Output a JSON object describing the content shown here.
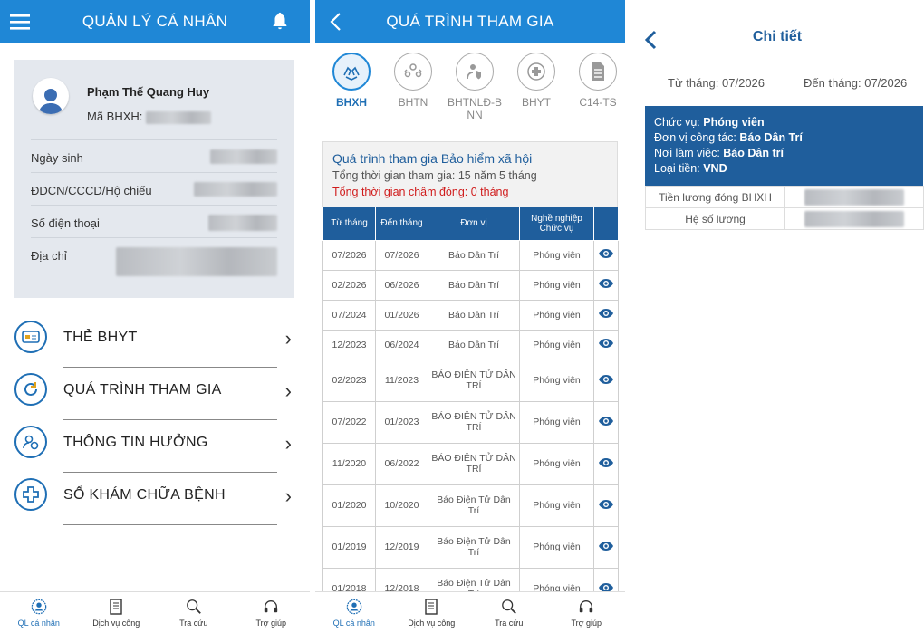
{
  "p1": {
    "title": "QUẢN LÝ CÁ NHÂN",
    "profile": {
      "name": "Phạm Thế Quang Huy",
      "code_label": "Mã BHXH:"
    },
    "fields": [
      "Ngày sinh",
      "ĐDCN/CCCD/Hộ chiếu",
      "Số điện thoại",
      "Địa chỉ"
    ],
    "menu": [
      "THẺ BHYT",
      "QUÁ TRÌNH THAM GIA",
      "THÔNG TIN HƯỞNG",
      "SỔ KHÁM CHỮA BỆNH"
    ]
  },
  "nav": [
    "QL cá nhân",
    "Dịch vụ công",
    "Tra cứu",
    "Trợ giúp"
  ],
  "p2": {
    "title": "QUÁ TRÌNH THAM GIA",
    "tabs": [
      "BHXH",
      "BHTN",
      "BHTNLĐ-B NN",
      "BHYT",
      "C14-TS"
    ],
    "summary": {
      "title": "Quá trình tham gia Bảo hiểm xã hội",
      "total": "Tổng thời gian tham gia: 15 năm 5 tháng",
      "late": "Tổng thời gian chậm đóng: 0 tháng"
    },
    "headers": [
      "Từ tháng",
      "Đến tháng",
      "Đơn vị",
      "Nghề nghiệp Chức vụ"
    ],
    "rows": [
      {
        "from": "07/2026",
        "to": "07/2026",
        "unit": "Báo Dân Trí",
        "job": "Phóng viên"
      },
      {
        "from": "02/2026",
        "to": "06/2026",
        "unit": "Báo Dân Trí",
        "job": "Phóng viên"
      },
      {
        "from": "07/2024",
        "to": "01/2026",
        "unit": "Báo Dân Trí",
        "job": "Phóng viên"
      },
      {
        "from": "12/2023",
        "to": "06/2024",
        "unit": "Báo Dân Trí",
        "job": "Phóng viên"
      },
      {
        "from": "02/2023",
        "to": "11/2023",
        "unit": "BÁO ĐIỆN TỬ DÂN TRÍ",
        "job": "Phóng viên"
      },
      {
        "from": "07/2022",
        "to": "01/2023",
        "unit": "BÁO ĐIỆN TỬ DÂN TRÍ",
        "job": "Phóng viên"
      },
      {
        "from": "11/2020",
        "to": "06/2022",
        "unit": "BÁO ĐIỆN TỬ DÂN TRÍ",
        "job": "Phóng viên"
      },
      {
        "from": "01/2020",
        "to": "10/2020",
        "unit": "Báo Điện Tử Dân Trí",
        "job": "Phóng viên"
      },
      {
        "from": "01/2019",
        "to": "12/2019",
        "unit": "Báo Điện Tử Dân Trí",
        "job": "Phóng viên"
      },
      {
        "from": "01/2018",
        "to": "12/2018",
        "unit": "Báo Điện Tử Dân Trí",
        "job": "Phóng viên"
      }
    ]
  },
  "p3": {
    "title": "Chi tiết",
    "from": "Từ tháng: 07/2026",
    "to": "Đến tháng: 07/2026",
    "detail": {
      "pos_label": "Chức vụ:",
      "pos": "Phóng viên",
      "unit_label": "Đơn vị công tác:",
      "unit": "Báo Dân Trí",
      "place_label": "Nơi làm việc:",
      "place": "Báo Dân trí",
      "cur_label": "Loại tiền:",
      "cur": "VND"
    },
    "rows": [
      "Tiền lương đóng BHXH",
      "Hệ số lương"
    ]
  },
  "colors": {
    "header": "#1f87d6",
    "dark": "#1f5e9c",
    "late": "#d01c1c"
  }
}
